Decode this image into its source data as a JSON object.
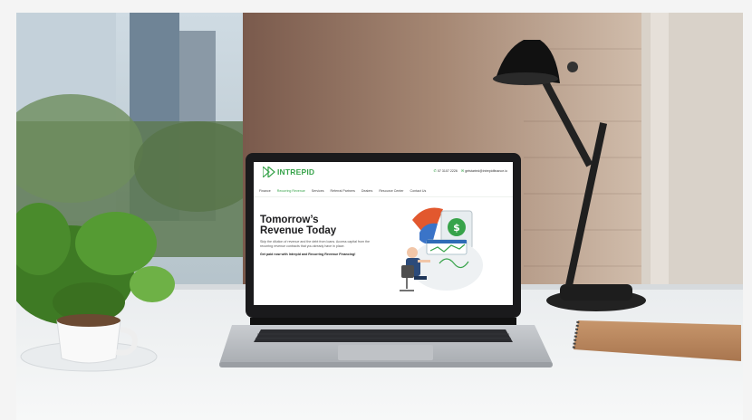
{
  "site": {
    "logo_text": "INTREPID",
    "phone": "07 3107 2226",
    "email": "getstarted@intrepidfinance.io",
    "nav": [
      {
        "label": "Finance"
      },
      {
        "label": "Recurring Revenue",
        "active": true
      },
      {
        "label": "Services"
      },
      {
        "label": "Referral Partners"
      },
      {
        "label": "Dealers"
      },
      {
        "label": "Resource Center"
      },
      {
        "label": "Contact Us"
      }
    ],
    "hero_title_line1": "Tomorrow’s",
    "hero_title_line2": "Revenue Today",
    "hero_body": "Skip the dilution of revenue and the debt from loans. Access capital from the recurring revenue contracts that you already have in place.",
    "hero_cta": "Get paid now with Intrepid and Recurring Revenue Financing!"
  },
  "colors": {
    "brand": "#37a34a",
    "heading": "#1d1d1f"
  },
  "icons": [
    "phone-icon",
    "mail-icon",
    "logo-chevrons-icon",
    "dollar-icon"
  ]
}
